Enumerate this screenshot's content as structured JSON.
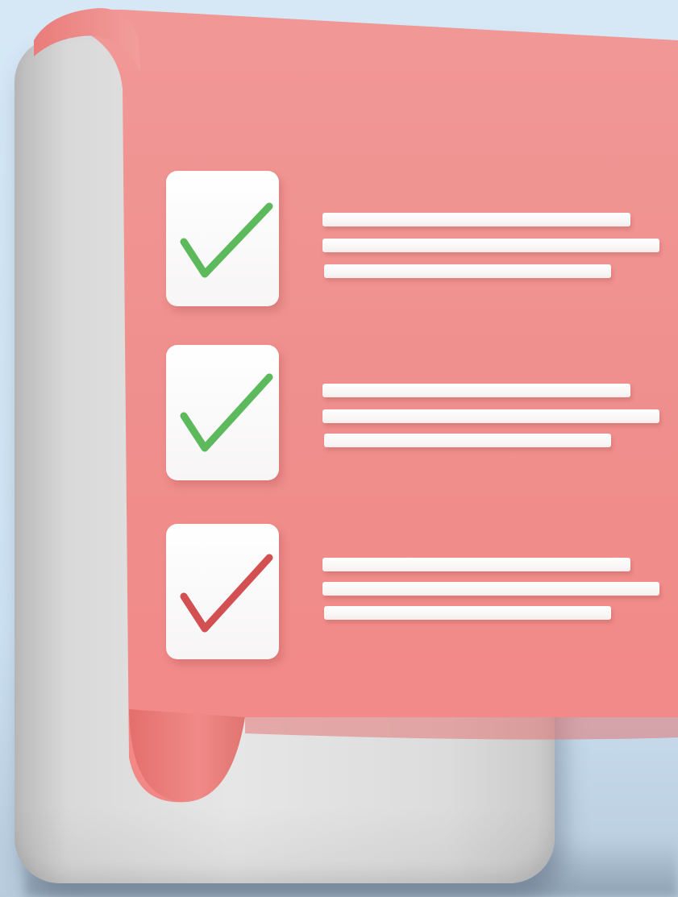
{
  "palette": {
    "paper": "#f08e8c",
    "paper_edge": "#e77b78",
    "board": "#dcdcdc",
    "checkbox": "#ffffff",
    "check_green": "#5cba5c",
    "check_red": "#d24f52",
    "line": "#fbf6f6",
    "background": "#d3e6f5"
  },
  "checklist": {
    "items": [
      {
        "icon": "green-checkmark-icon",
        "check_color": "#5cba5c"
      },
      {
        "icon": "green-checkmark-icon",
        "check_color": "#5cba5c"
      },
      {
        "icon": "red-checkmark-icon",
        "check_color": "#d24f52"
      }
    ]
  }
}
